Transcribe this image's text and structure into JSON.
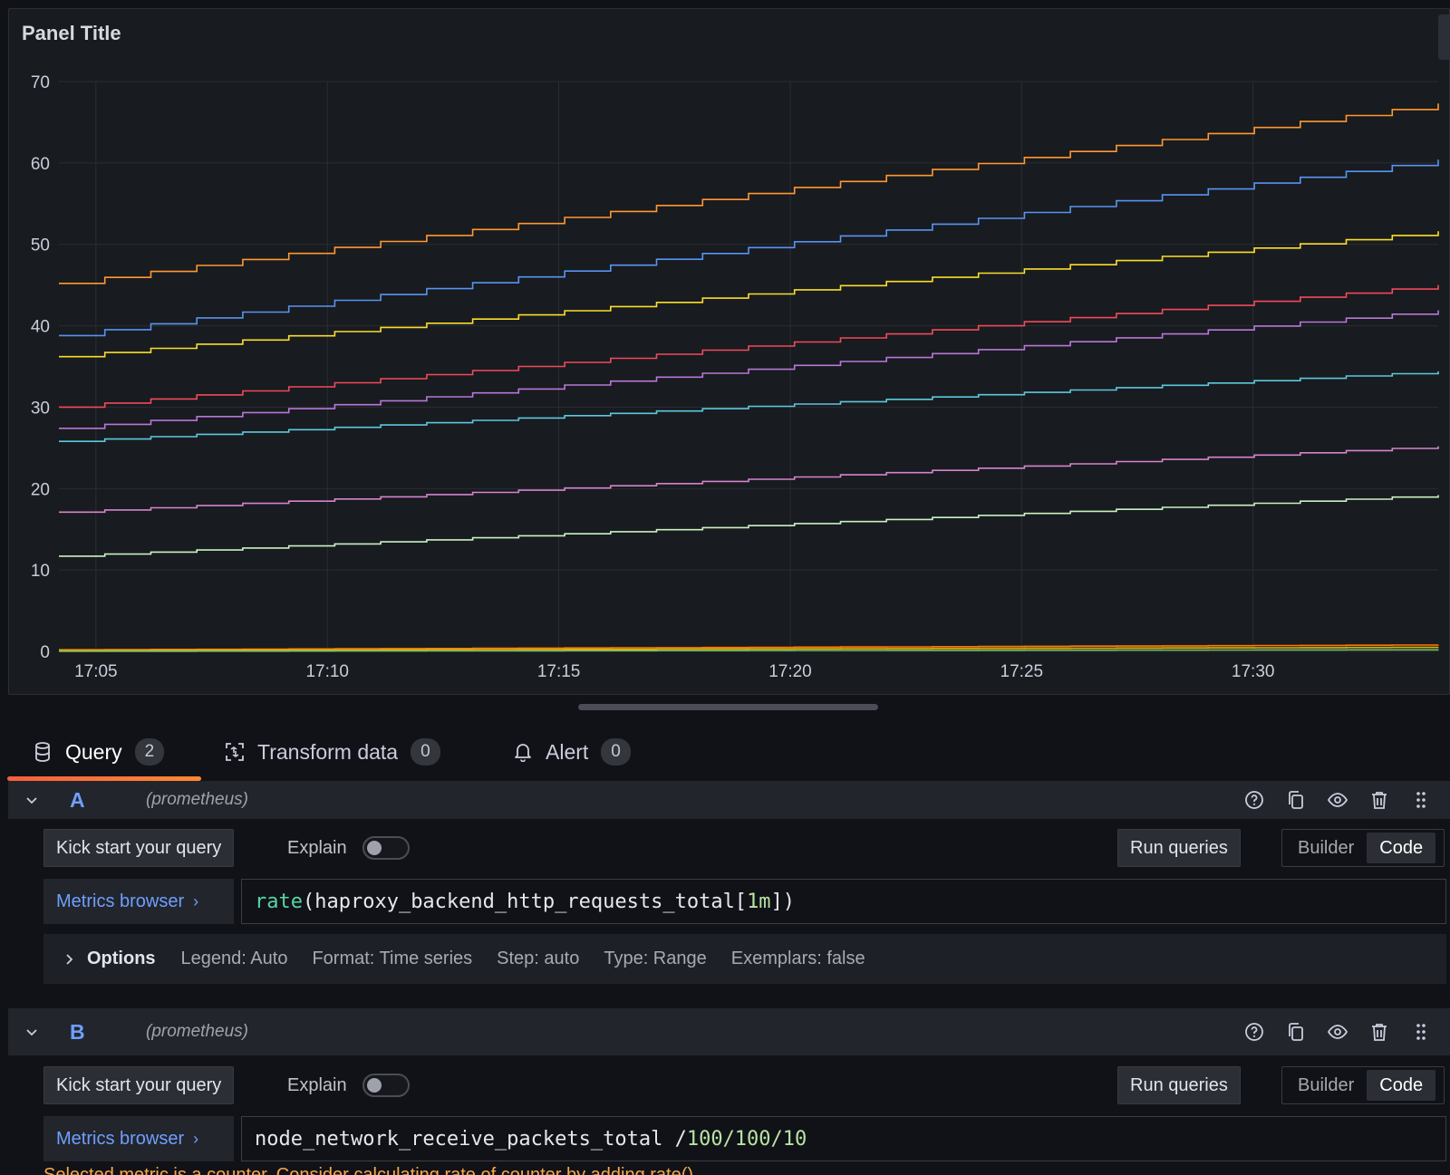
{
  "panel": {
    "title": "Panel Title"
  },
  "chart_data": {
    "type": "line",
    "x_tick_labels": [
      "17:05",
      "17:10",
      "17:15",
      "17:20",
      "17:25",
      "17:30"
    ],
    "x_start_minute": 4.2,
    "x_end_minute": 34,
    "ylim": [
      0,
      70
    ],
    "yticks": [
      0,
      10,
      20,
      30,
      40,
      50,
      60,
      70
    ],
    "grid": true,
    "legend": "none",
    "series": [
      {
        "color": "#ff9830",
        "start": 45.2,
        "end": 67.3
      },
      {
        "color": "#5794f2",
        "start": 38.8,
        "end": 60.4
      },
      {
        "color": "#fade2a",
        "start": 36.2,
        "end": 51.6
      },
      {
        "color": "#f2495c",
        "start": 30.0,
        "end": 45.0
      },
      {
        "color": "#b877d9",
        "start": 27.4,
        "end": 41.9
      },
      {
        "color": "#5cc8e0",
        "start": 25.8,
        "end": 34.4
      },
      {
        "color": "#d683ce",
        "start": 17.1,
        "end": 25.2
      },
      {
        "color": "#c8f2c2",
        "start": 11.7,
        "end": 19.2
      },
      {
        "color": "#ff780a",
        "start": 0.2,
        "end": 0.8
      },
      {
        "color": "#e0b400",
        "start": 0.1,
        "end": 0.5
      },
      {
        "color": "#73bf69",
        "start": 0.0,
        "end": 0.2
      }
    ]
  },
  "tabs": [
    {
      "label": "Query",
      "count": "2"
    },
    {
      "label": "Transform data",
      "count": "0"
    },
    {
      "label": "Alert",
      "count": "0"
    }
  ],
  "queries": [
    {
      "ref_id": "A",
      "datasource": "(prometheus)",
      "kick_start": "Kick start your query",
      "explain": "Explain",
      "run": "Run queries",
      "builder": "Builder",
      "code": "Code",
      "metrics_browser": "Metrics browser",
      "expr_fn": "rate",
      "expr_open": "(haproxy_backend_http_requests_total[",
      "expr_num": "1m",
      "expr_close": "])",
      "options": {
        "title": "Options",
        "legend": "Legend: Auto",
        "format": "Format: Time series",
        "step": "Step: auto",
        "type": "Type: Range",
        "exemplars": "Exemplars: false"
      }
    },
    {
      "ref_id": "B",
      "datasource": "(prometheus)",
      "kick_start": "Kick start your query",
      "explain": "Explain",
      "run": "Run queries",
      "builder": "Builder",
      "code": "Code",
      "metrics_browser": "Metrics browser",
      "expr_text": "node_network_receive_packets_total /",
      "expr_num": "100/100/10",
      "warning": "Selected metric is a counter. Consider calculating rate of counter by adding rate()."
    }
  ]
}
